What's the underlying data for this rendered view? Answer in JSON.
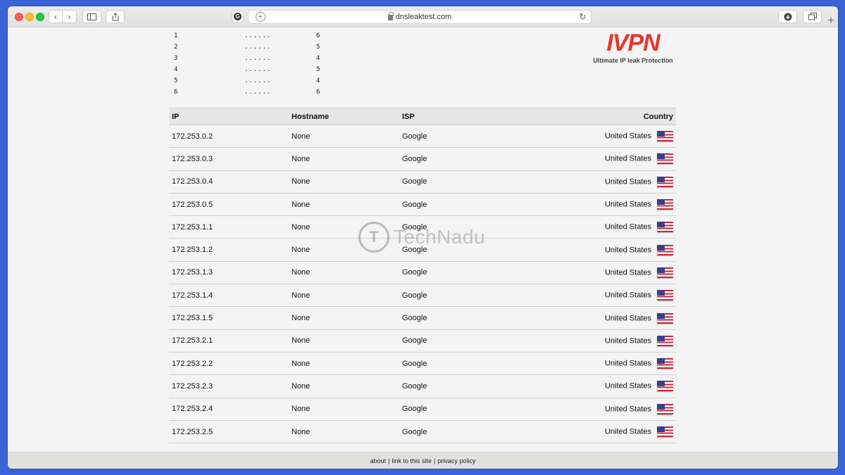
{
  "browser": {
    "address": "dnsleaktest.com",
    "back_icon": "‹",
    "forward_icon": "›",
    "reload_icon": "↻",
    "new_tab_icon": "+"
  },
  "progress": [
    {
      "n": "1",
      "dots": "......",
      "count": "6"
    },
    {
      "n": "2",
      "dots": "......",
      "count": "5"
    },
    {
      "n": "3",
      "dots": "......",
      "count": "4"
    },
    {
      "n": "4",
      "dots": "......",
      "count": "5"
    },
    {
      "n": "5",
      "dots": "......",
      "count": "4"
    },
    {
      "n": "6",
      "dots": "......",
      "count": "6"
    }
  ],
  "ad": {
    "logo": "IVPN",
    "tagline": "Ultimate IP leak Protection",
    "logo_color": "#e5382e"
  },
  "table": {
    "headers": {
      "ip": "IP",
      "hostname": "Hostname",
      "isp": "ISP",
      "country": "Country"
    },
    "rows": [
      {
        "ip": "172.253.0.2",
        "hostname": "None",
        "isp": "Google",
        "country": "United States"
      },
      {
        "ip": "172.253.0.3",
        "hostname": "None",
        "isp": "Google",
        "country": "United States"
      },
      {
        "ip": "172.253.0.4",
        "hostname": "None",
        "isp": "Google",
        "country": "United States"
      },
      {
        "ip": "172.253.0.5",
        "hostname": "None",
        "isp": "Google",
        "country": "United States"
      },
      {
        "ip": "172.253.1.1",
        "hostname": "None",
        "isp": "Google",
        "country": "United States"
      },
      {
        "ip": "172.253.1.2",
        "hostname": "None",
        "isp": "Google",
        "country": "United States"
      },
      {
        "ip": "172.253.1.3",
        "hostname": "None",
        "isp": "Google",
        "country": "United States"
      },
      {
        "ip": "172.253.1.4",
        "hostname": "None",
        "isp": "Google",
        "country": "United States"
      },
      {
        "ip": "172.253.1.5",
        "hostname": "None",
        "isp": "Google",
        "country": "United States"
      },
      {
        "ip": "172.253.2.1",
        "hostname": "None",
        "isp": "Google",
        "country": "United States"
      },
      {
        "ip": "172.253.2.2",
        "hostname": "None",
        "isp": "Google",
        "country": "United States"
      },
      {
        "ip": "172.253.2.3",
        "hostname": "None",
        "isp": "Google",
        "country": "United States"
      },
      {
        "ip": "172.253.2.4",
        "hostname": "None",
        "isp": "Google",
        "country": "United States"
      },
      {
        "ip": "172.253.2.5",
        "hostname": "None",
        "isp": "Google",
        "country": "United States"
      }
    ]
  },
  "watermark": {
    "text": "TechNadu",
    "mark": "T"
  },
  "footer": {
    "about": "about",
    "link": "link to this site",
    "privacy": "privacy policy",
    "separator": "|"
  }
}
